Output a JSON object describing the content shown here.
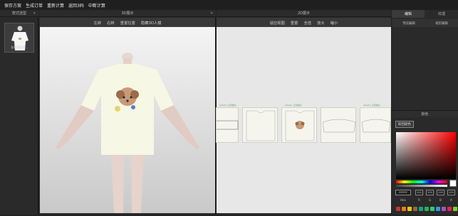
{
  "menu": [
    "保存方案",
    "生成订单",
    "重新计算",
    "返回3码",
    "中断计算"
  ],
  "left_panel": {
    "title": "款式选型",
    "thumb_label": "长袖薄柔衫..."
  },
  "panel3d": {
    "title": "3D展示",
    "tools": [
      "左转",
      "右转",
      "重置拉置",
      "隐藏3D人模"
    ]
  },
  "panel2d": {
    "title": "2D展示",
    "tools": [
      "适应视图",
      "重置",
      "全选",
      "放大",
      "缩小"
    ],
    "pieces": [
      {
        "label": "simple: 正身裁片"
      },
      {
        "label": ""
      },
      {
        "label": "simple: 正身裁片"
      },
      {
        "label": ""
      },
      {
        "label": "simple: 正身裁片"
      }
    ]
  },
  "right_panel": {
    "tabs": [
      "编辑",
      "纹理"
    ],
    "subtabs": [
      "预览编辑",
      "裁剪编辑"
    ],
    "color_title": "颜色",
    "color_button": "取回颜色",
    "color_inputs": {
      "hex": "FFFFFF",
      "r": "255",
      "g": "255",
      "b": "255",
      "a": "255"
    },
    "labels": [
      "Hex",
      "R",
      "G",
      "B",
      "A"
    ],
    "swatches": [
      "#c0392b",
      "#e67e22",
      "#f1c40f",
      "#8e6b3a",
      "#16a085",
      "#27ae60",
      "#2ecc71",
      "#3498db",
      "#9b59b6",
      "#e91e63",
      "#7ed321"
    ]
  },
  "colors": {
    "accent": "#ffffff",
    "menubar": "#1f1f1f",
    "panel": "#2a2a2a"
  }
}
